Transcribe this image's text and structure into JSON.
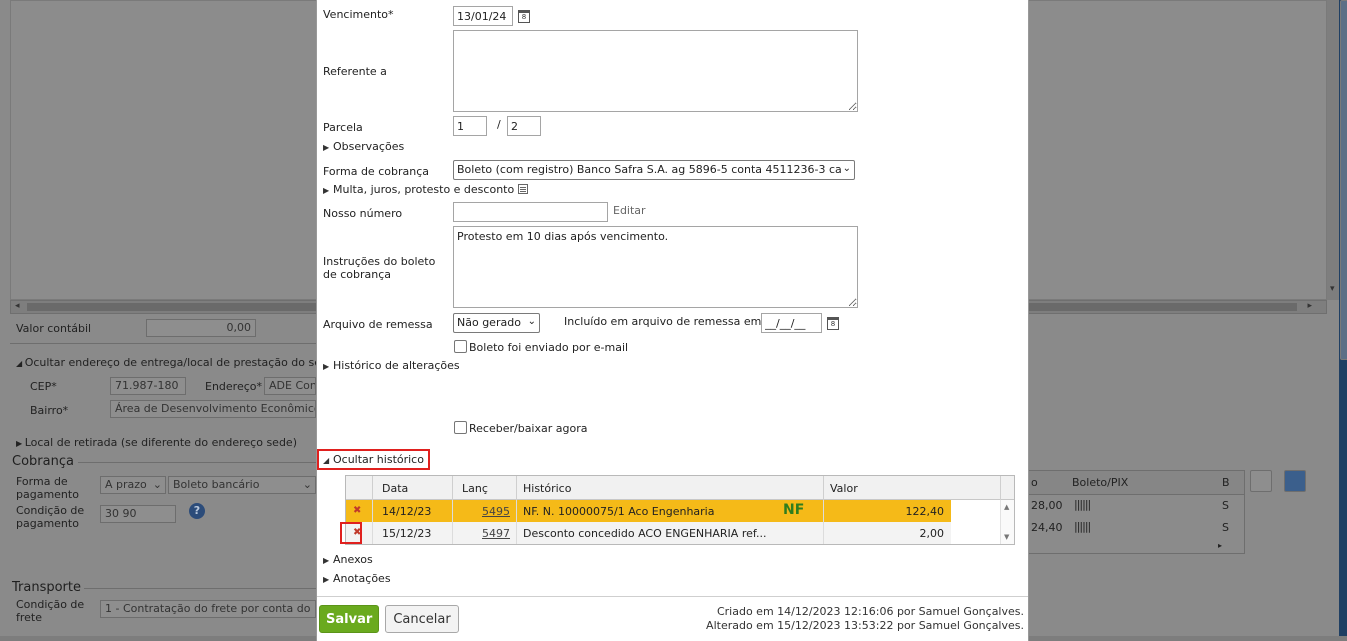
{
  "background": {
    "valor_contabil_label": "Valor contábil",
    "valor_contabil_value": "0,00",
    "ocultar_endereco_label": "Ocultar endereço de entrega/local de prestação do se",
    "cep_label": "CEP*",
    "cep_value": "71.987-180",
    "endereco_label": "Endereço*",
    "endereco_value": "ADE Con",
    "bairro_label": "Bairro*",
    "bairro_value": "Área de Desenvolvimento Econômico",
    "local_retirada_label": "Local de retirada (se diferente do endereço sede)",
    "cobranca_section": "Cobrança",
    "forma_pagamento_label": "Forma de pagamento",
    "forma_pagamento_value": "A prazo",
    "boleto_bancario_value": "Boleto bancário",
    "condicao_pagamento_label": "Condição de pagamento",
    "condicao_pagamento_value": "30 90",
    "help_glyph": "?",
    "transporte_section": "Transporte",
    "condicao_frete_label": "Condição de frete",
    "condicao_frete_value": "1 - Contratação do frete por conta do",
    "right_table": {
      "col_o": "o",
      "col_boleto": "Boleto/PIX",
      "col_b": "B",
      "rows": [
        {
          "valor": "28,00",
          "b": "S"
        },
        {
          "valor": "24,40",
          "b": "S"
        }
      ]
    }
  },
  "modal": {
    "vencimento_label": "Vencimento*",
    "vencimento_value": "13/01/24",
    "referente_label": "Referente a",
    "referente_value": "",
    "parcela_label": "Parcela",
    "parcela_atual": "1",
    "parcela_sep": "/",
    "parcela_total": "2",
    "observacoes_toggle": "Observações",
    "forma_cobranca_label": "Forma de cobrança",
    "forma_cobranca_value": "Boleto (com registro) Banco Safra S.A. ag 5896-5 conta 4511236-3 ca",
    "multa_toggle": "Multa, juros, protesto e desconto",
    "nosso_numero_label": "Nosso número",
    "nosso_numero_value": "",
    "editar_link": "Editar",
    "instrucoes_label": "Instruções do boleto de cobrança",
    "instrucoes_value": "Protesto em 10 dias após vencimento.",
    "arquivo_remessa_label": "Arquivo de remessa",
    "arquivo_remessa_value": "Não gerado",
    "incluido_label": "Incluído em arquivo de remessa em",
    "incluido_value": "__/__/__",
    "boleto_email_label": "Boleto foi enviado por e-mail",
    "historico_alteracoes_toggle": "Histórico de alterações",
    "receber_label": "Receber/baixar agora",
    "ocultar_historico_toggle": "Ocultar histórico",
    "history": {
      "columns": [
        "Data",
        "Lanç",
        "Histórico",
        "Valor"
      ],
      "rows": [
        {
          "data": "14/12/23",
          "lanc": "5495",
          "historico": "NF. N. 10000075/1 Aco Engenharia",
          "badge": "NF",
          "valor": "122,40"
        },
        {
          "data": "15/12/23",
          "lanc": "5497",
          "historico": "Desconto concedido ACO ENGENHARIA ref...",
          "badge": "",
          "valor": "2,00"
        }
      ]
    },
    "anexos_toggle": "Anexos",
    "anotacoes_toggle": "Anotações",
    "save_label": "Salvar",
    "cancel_label": "Cancelar",
    "criado_text": "Criado em 14/12/2023 12:16:06 por Samuel Gonçalves.",
    "alterado_text": "Alterado em 15/12/2023 13:53:22 por Samuel Gonçalves."
  },
  "colors": {
    "selected_row": "#f5ba18",
    "save_button": "#6aaa1e",
    "highlight_box": "#e0201e",
    "nf_badge": "#2e7d1e"
  }
}
